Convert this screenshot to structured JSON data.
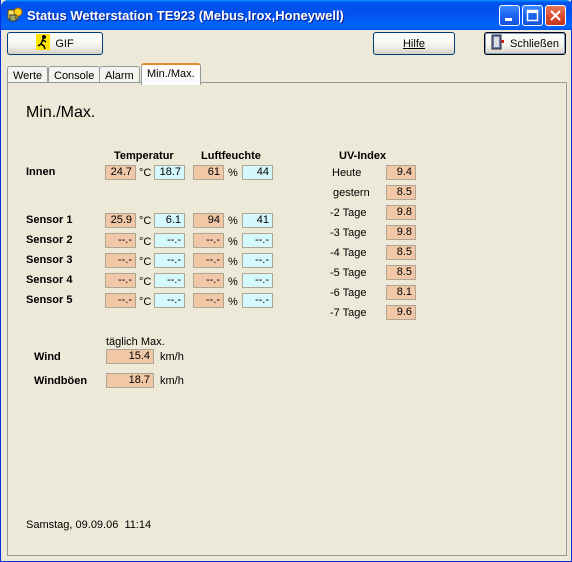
{
  "window": {
    "title": "Status Wetterstation TE923 (Mebus,Irox,Honeywell)"
  },
  "toolbar": {
    "gif_label": "GIF",
    "help_label": "Hilfe",
    "close_label": "Schließen"
  },
  "tabs": [
    {
      "label": "Werte"
    },
    {
      "label": "Console"
    },
    {
      "label": "Alarm"
    },
    {
      "label": "Min./Max."
    }
  ],
  "page": {
    "heading": "Min./Max."
  },
  "headers": {
    "temperature": "Temperatur",
    "humidity": "Luftfeuchte",
    "uv": "UV-Index"
  },
  "units": {
    "celsius": "°C",
    "percent": "%",
    "kmh": "km/h"
  },
  "sensors": [
    {
      "name": "Innen",
      "temp_min": "24.7",
      "temp_max": "18.7",
      "hum_min": "61",
      "hum_max": "44"
    },
    {
      "name": "Sensor 1",
      "temp_min": "25.9",
      "temp_max": "6.1",
      "hum_min": "94",
      "hum_max": "41"
    },
    {
      "name": "Sensor 2",
      "temp_min": "--.-",
      "temp_max": "--.-",
      "hum_min": "--.-",
      "hum_max": "--.-"
    },
    {
      "name": "Sensor 3",
      "temp_min": "--.-",
      "temp_max": "--.-",
      "hum_min": "--.-",
      "hum_max": "--.-"
    },
    {
      "name": "Sensor 4",
      "temp_min": "--.-",
      "temp_max": "--.-",
      "hum_min": "--.-",
      "hum_max": "--.-"
    },
    {
      "name": "Sensor 5",
      "temp_min": "--.-",
      "temp_max": "--.-",
      "hum_min": "--.-",
      "hum_max": "--.-"
    }
  ],
  "uv_index": [
    {
      "day": "Heute",
      "value": "9.4"
    },
    {
      "day": "gestern",
      "value": "8.5"
    },
    {
      "day": "-2 Tage",
      "value": "9.8"
    },
    {
      "day": "-3 Tage",
      "value": "9.8"
    },
    {
      "day": "-4 Tage",
      "value": "8.5"
    },
    {
      "day": "-5 Tage",
      "value": "8.5"
    },
    {
      "day": "-6 Tage",
      "value": "8.1"
    },
    {
      "day": "-7 Tage",
      "value": "9.6"
    }
  ],
  "wind": {
    "caption": "täglich Max.",
    "wind_label": "Wind",
    "wind_value": "15.4",
    "gust_label": "Windböen",
    "gust_value": "18.7"
  },
  "status": {
    "datetime": "Samstag, 09.09.06  11:14"
  },
  "colors": {
    "min_box": "#f0c8a8",
    "max_box": "#d4f8fc",
    "titlebar": "#0053ee"
  }
}
